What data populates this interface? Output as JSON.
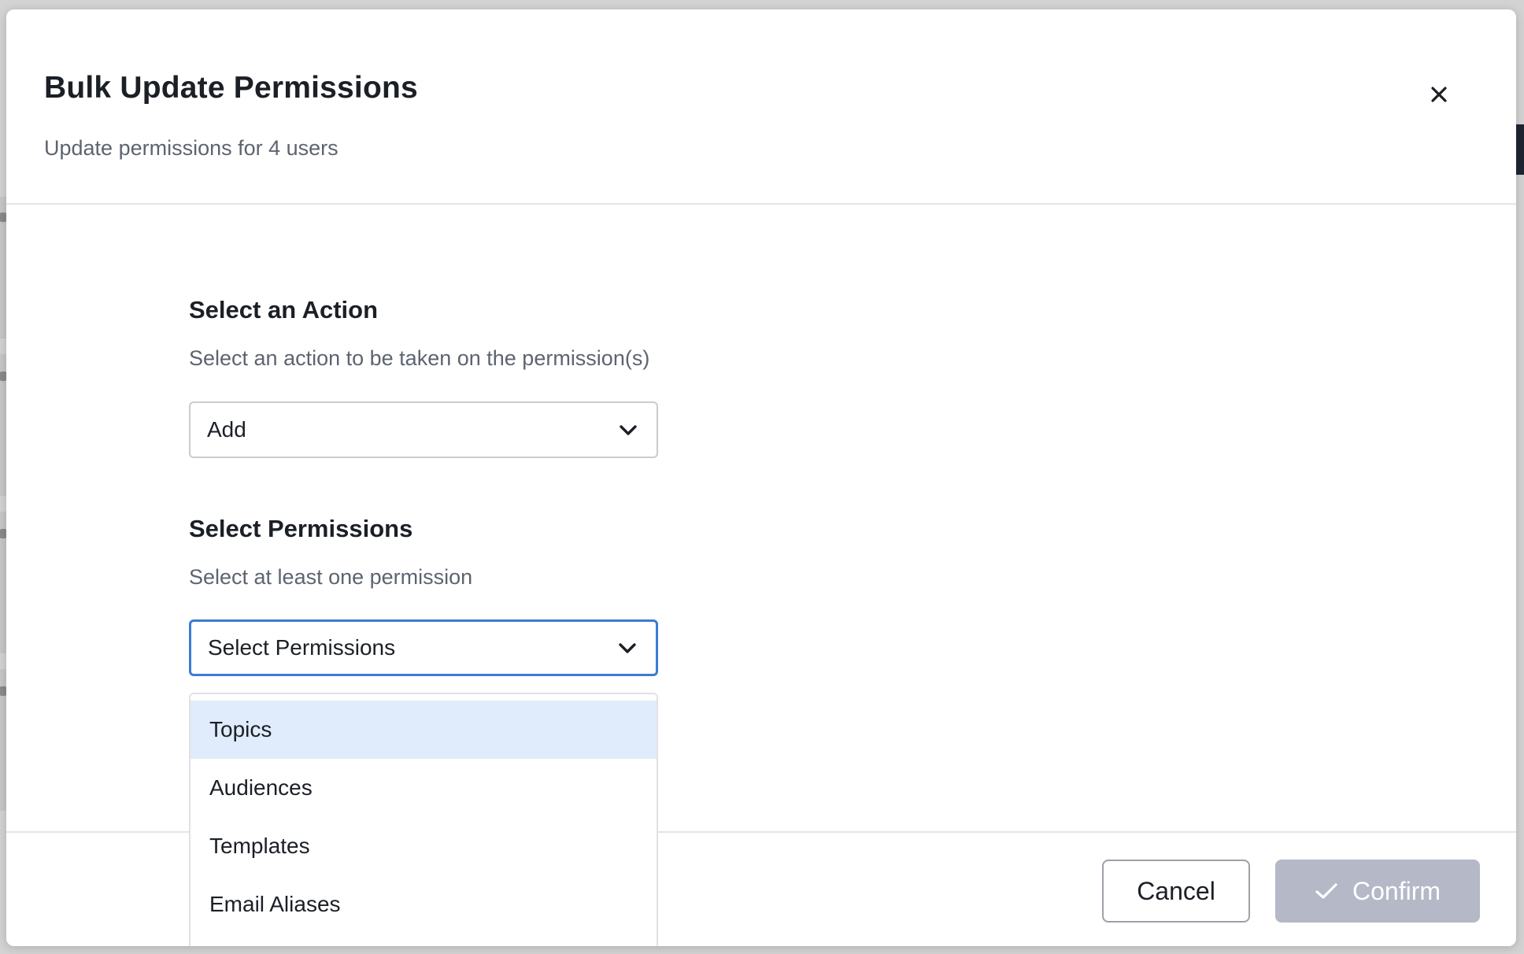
{
  "modal": {
    "title": "Bulk Update Permissions",
    "subtitle": "Update permissions for 4 users",
    "close_icon": "close-icon"
  },
  "action_section": {
    "title": "Select an Action",
    "help": "Select an action to be taken on the permission(s)",
    "selected_value": "Add"
  },
  "permissions_section": {
    "title": "Select Permissions",
    "help": "Select at least one permission",
    "placeholder": "Select Permissions",
    "options": [
      {
        "label": "Topics",
        "highlighted": true
      },
      {
        "label": "Audiences",
        "highlighted": false
      },
      {
        "label": "Templates",
        "highlighted": false
      },
      {
        "label": "Email Aliases",
        "highlighted": false
      }
    ]
  },
  "footer": {
    "cancel_label": "Cancel",
    "confirm_label": "Confirm",
    "confirm_icon": "check-icon"
  },
  "colors": {
    "focus_border": "#3b7bd4",
    "option_highlight": "#e0ebfb",
    "confirm_disabled": "#b4b8c7"
  }
}
